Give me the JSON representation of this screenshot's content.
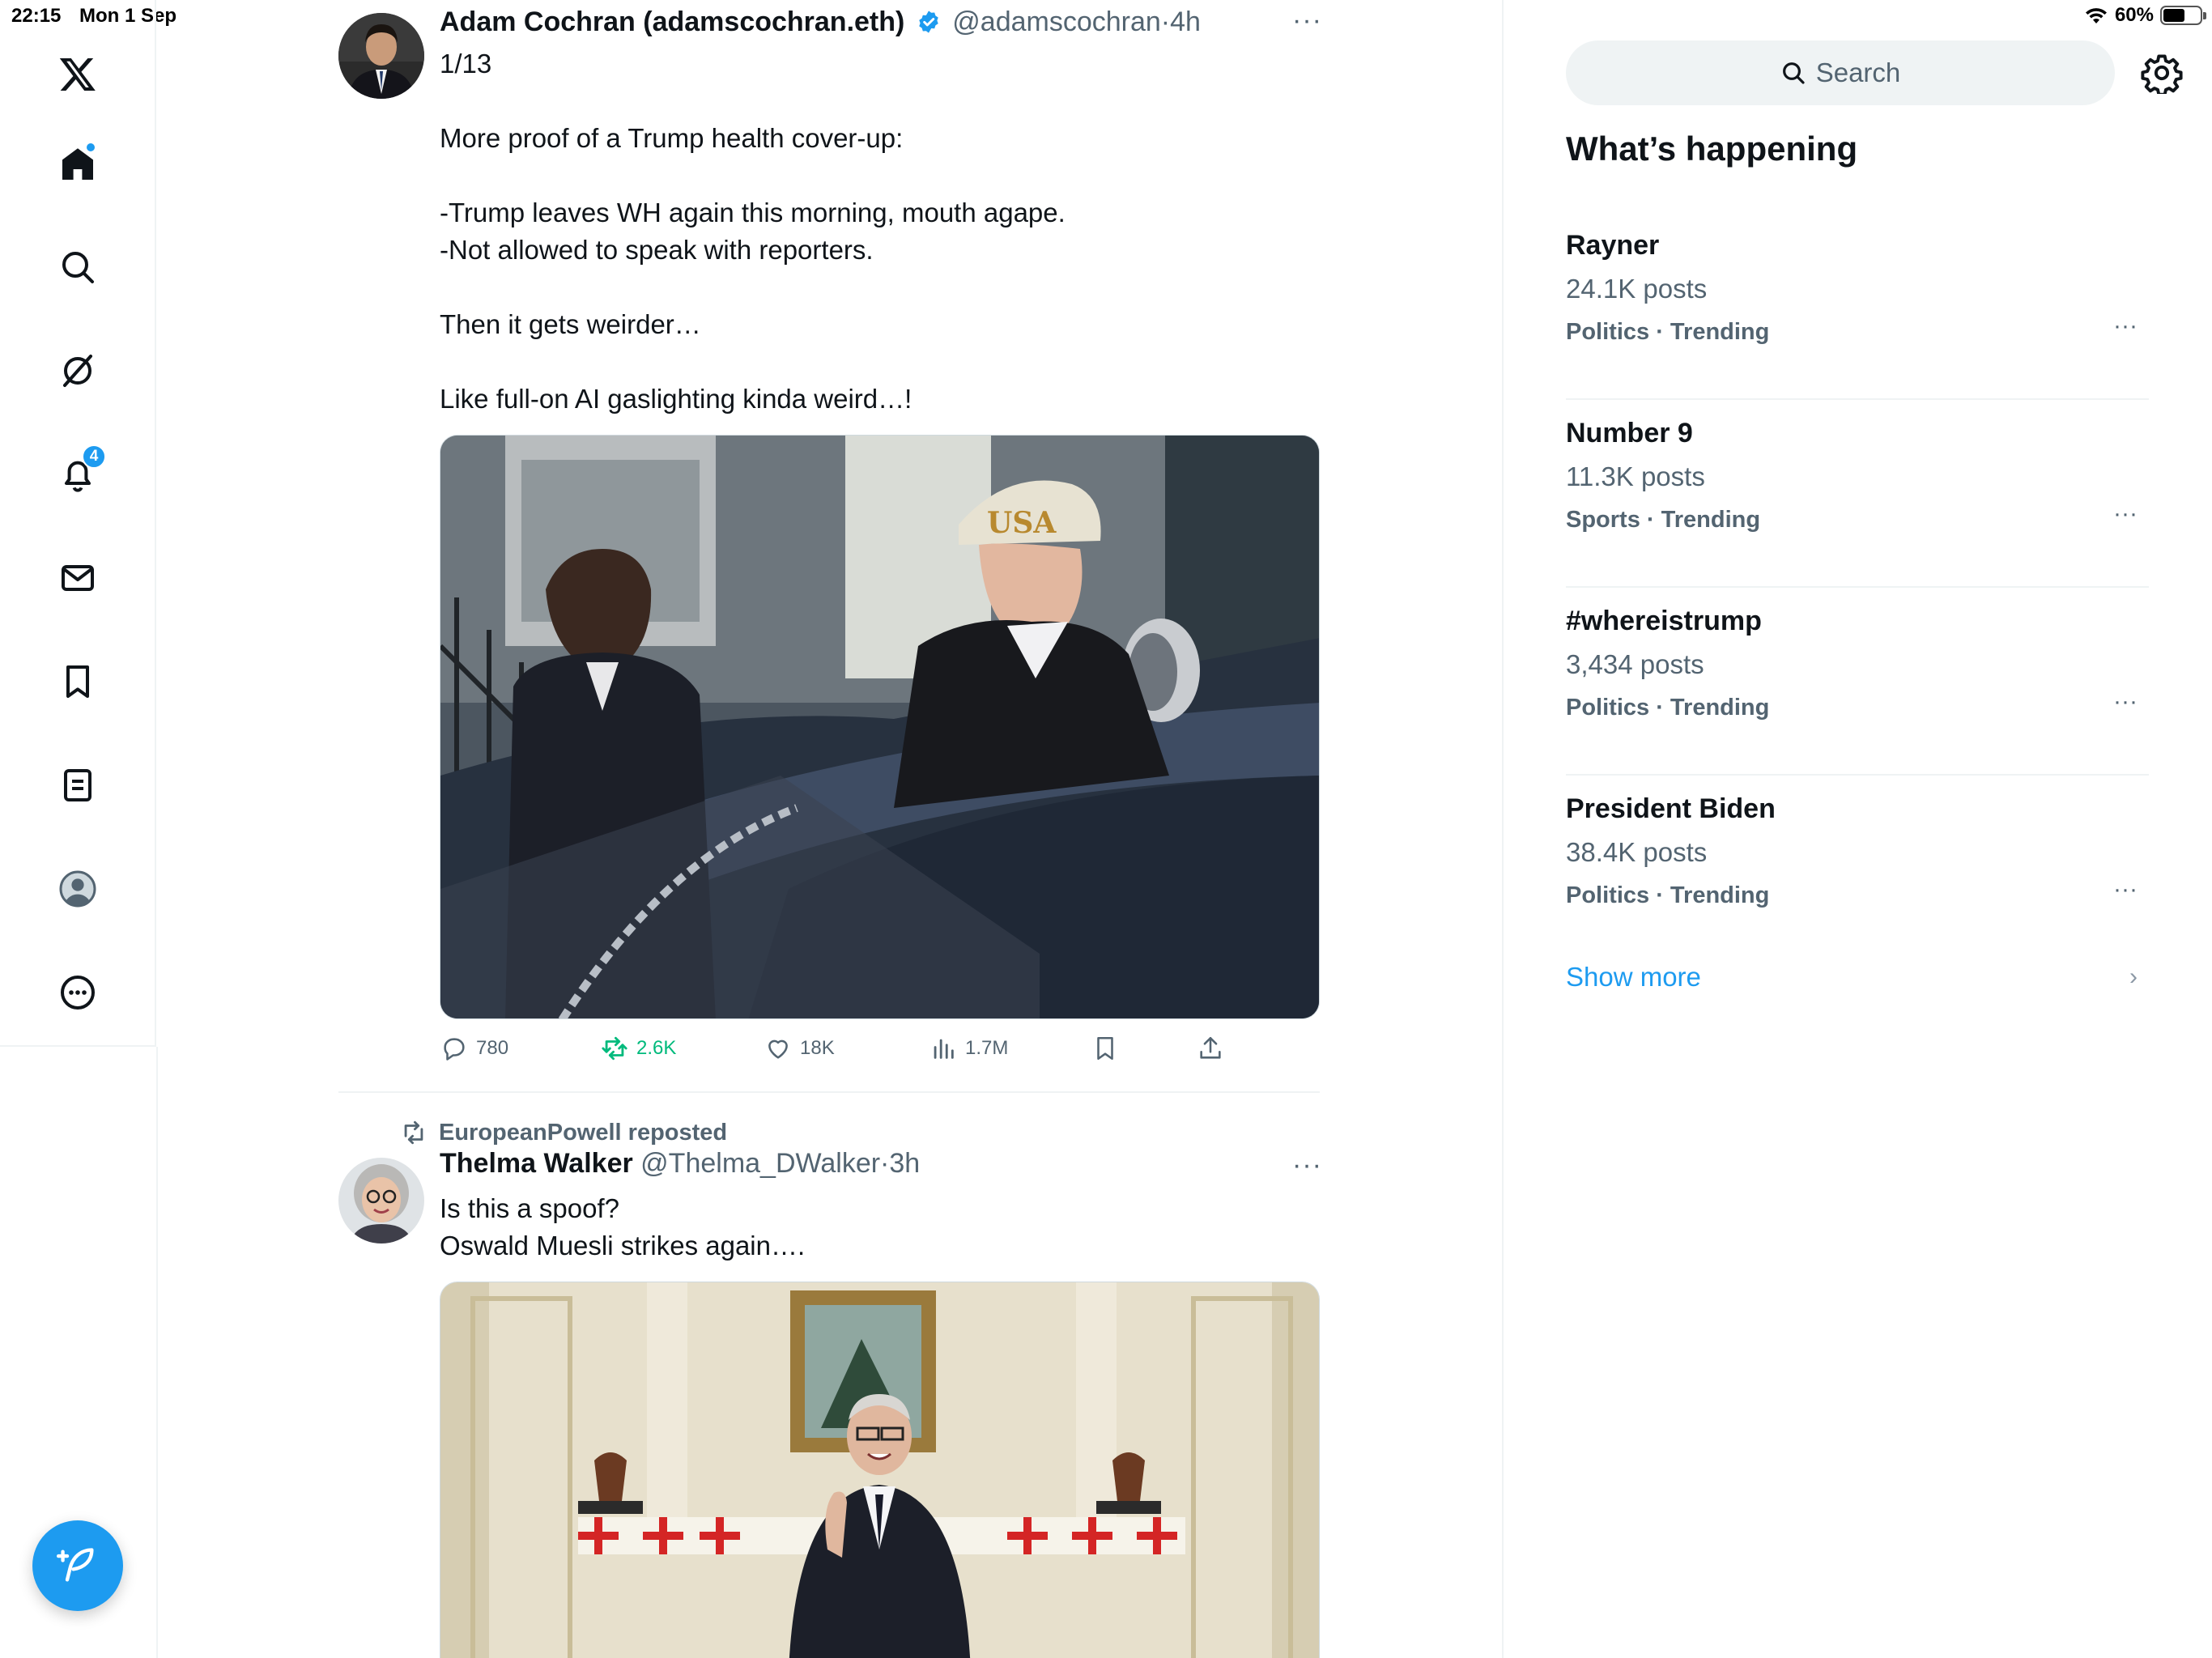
{
  "status_bar": {
    "time": "22:15",
    "date": "Mon 1 Sep",
    "battery_text": "60%",
    "battery_level": 0.6
  },
  "nav": {
    "notifications_badge": "4",
    "accent_color": "#1d9bf0"
  },
  "tweets": [
    {
      "name": "Adam Cochran (adamscochran.eth)",
      "handle": "@adamscochran",
      "separator": "·",
      "time": "4h",
      "verified": true,
      "lines": [
        "1/13",
        "",
        "More proof of a Trump health cover-up:",
        "",
        "-Trump leaves WH again this morning, mouth agape.",
        "-Not allowed to speak with reporters.",
        "",
        "Then it gets weirder…",
        "",
        "Like full-on AI gaslighting kinda weird…!"
      ],
      "stats": {
        "replies": "780",
        "reposts": "2.6K",
        "likes": "18K",
        "views": "1.7M"
      }
    },
    {
      "repost_by": "EuropeanPowell reposted",
      "name": "Thelma Walker",
      "handle": "@Thelma_DWalker",
      "separator": "·",
      "time": "3h",
      "lines": [
        "Is this a spoof?",
        "Oswald Muesli strikes again…."
      ]
    }
  ],
  "sidebar": {
    "search_placeholder": "Search",
    "title": "What’s happening",
    "trends": [
      {
        "name": "Rayner",
        "count": "24.1K posts",
        "meta": "Politics · Trending"
      },
      {
        "name": "Number 9",
        "count": "11.3K posts",
        "meta": "Sports · Trending"
      },
      {
        "name": "#whereistrump",
        "count": "3,434 posts",
        "meta": "Politics · Trending"
      },
      {
        "name": "President Biden",
        "count": "38.4K posts",
        "meta": "Politics · Trending"
      }
    ],
    "show_more": "Show more"
  }
}
